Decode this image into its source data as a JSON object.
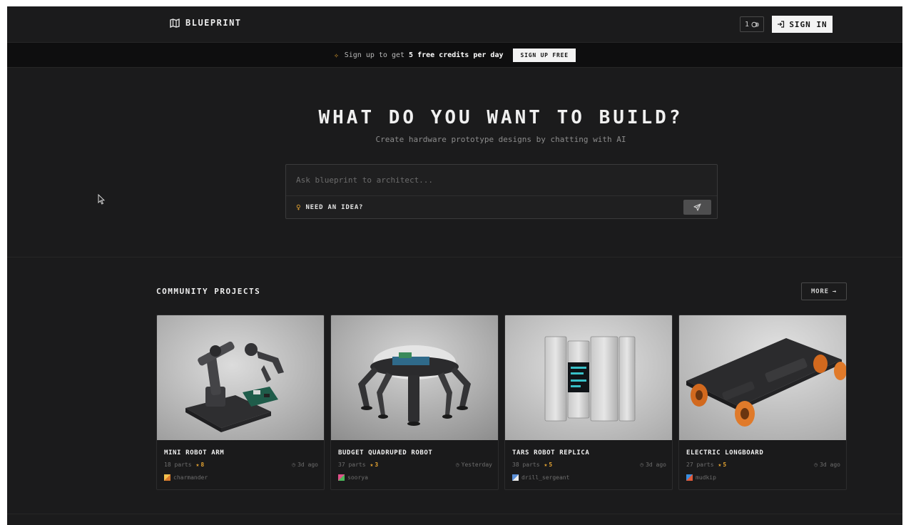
{
  "nav": {
    "brand": "BLUEPRINT",
    "credits_count": "1",
    "signin_label": "SIGN IN"
  },
  "banner": {
    "text_pre": "Sign up to get",
    "text_bold": "5 free credits per day",
    "cta_label": "SIGN UP FREE"
  },
  "hero": {
    "title": "WHAT DO YOU WANT TO BUILD?",
    "subtitle": "Create hardware prototype designs by chatting with AI",
    "input_placeholder": "Ask blueprint to architect...",
    "idea_label": "NEED AN IDEA?"
  },
  "community": {
    "title": "COMMUNITY PROJECTS",
    "more_label": "MORE",
    "projects": [
      {
        "title": "MINI ROBOT ARM",
        "parts": "18 parts",
        "rating": "8",
        "time": "3d ago",
        "author": "charmander",
        "avatar_color": "#e8a33a"
      },
      {
        "title": "BUDGET QUADRUPED ROBOT",
        "parts": "37 parts",
        "rating": "3",
        "time": "Yesterday",
        "author": "soorya",
        "avatar_color": "#4cb85a"
      },
      {
        "title": "TARS ROBOT REPLICA",
        "parts": "38 parts",
        "rating": "5",
        "time": "3d ago",
        "author": "drill_sergeant",
        "avatar_color": "#5a8fd8"
      },
      {
        "title": "ELECTRIC LONGBOARD",
        "parts": "27 parts",
        "rating": "5",
        "time": "3d ago",
        "author": "mudkip",
        "avatar_color": "#3a8fe0"
      }
    ]
  },
  "colors": {
    "accent": "#e3a230",
    "background": "#1b1b1c",
    "banner_bg": "#0e0e0f"
  }
}
